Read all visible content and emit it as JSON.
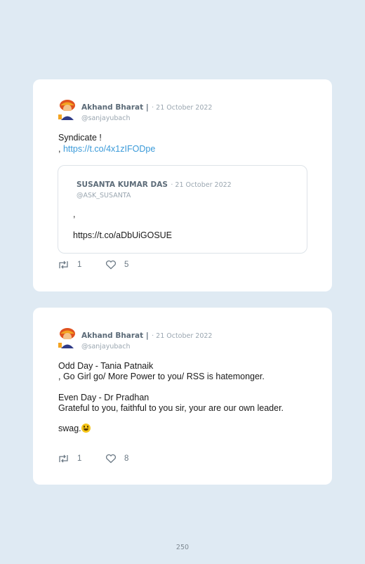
{
  "tweet1": {
    "author_name": "Akhand Bharat |",
    "date": "· 21 October 2022",
    "handle": "@sanjayubach",
    "text_line1": "Syndicate !",
    "text_prefix": ",",
    "link": "https://t.co/4x1zIFODpe",
    "quoted": {
      "author_name": "SUSANTA KUMAR DAS",
      "date": "· 21 October 2022",
      "handle": "@ASK_SUSANTA",
      "text": ",",
      "link": "https://t.co/aDbUiGOSUE"
    },
    "retweets": "1",
    "likes": "5"
  },
  "tweet2": {
    "author_name": "Akhand Bharat |",
    "date": "· 21 October 2022",
    "handle": "@sanjayubach",
    "lines": [
      "Odd Day - Tania Patnaik",
      ", Go Girl go/ More Power to you/ RSS is hatemonger.",
      "Even Day - Dr Pradhan",
      "Grateful to you, faithful to you sir, your are our own leader.",
      "swag."
    ],
    "retweets": "1",
    "likes": "8"
  },
  "page_number": "250",
  "icons": {
    "retweet": "retweet-icon",
    "like": "heart-icon",
    "emoji": "grinning-face-emoji"
  },
  "colors": {
    "background": "#dfeaf3",
    "card": "#ffffff",
    "link": "#3a9ad9"
  }
}
